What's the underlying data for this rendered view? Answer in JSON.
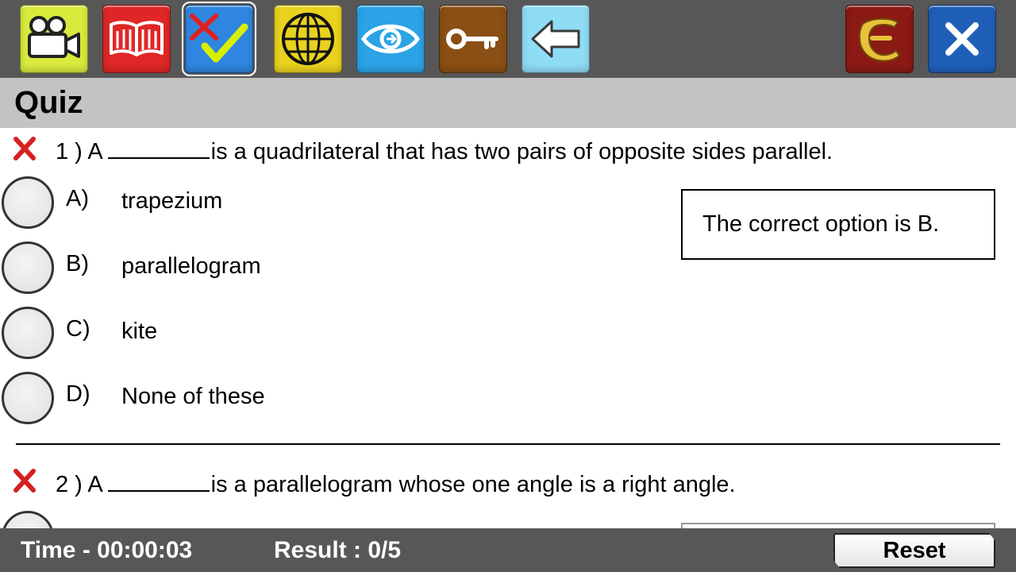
{
  "app": {
    "title": "Quiz"
  },
  "toolbar": {
    "buttons": [
      {
        "icon": "video-camera-icon",
        "color": "#d8ea3c"
      },
      {
        "icon": "open-book-icon",
        "color": "#e02626"
      },
      {
        "icon": "quiz-check-icon",
        "color": "#2f86e0",
        "active": true
      },
      {
        "icon": "globe-icon",
        "color": "#e9d21e"
      },
      {
        "icon": "eye-icon",
        "color": "#2ba3e6"
      },
      {
        "icon": "key-icon",
        "color": "#8a4f14"
      },
      {
        "icon": "back-arrow-icon",
        "color": "#8fdcf5"
      },
      {
        "icon": "brand-logo-icon",
        "color": "#8c1a14"
      },
      {
        "icon": "close-icon",
        "color": "#1f5fb8"
      }
    ]
  },
  "questions": [
    {
      "number": "1 )",
      "prefix": "A",
      "suffix": "is a quadrilateral that has two pairs of opposite sides parallel.",
      "status_icon": "wrong-x-icon",
      "options": [
        {
          "letter": "A)",
          "text": "trapezium"
        },
        {
          "letter": "B)",
          "text": "parallelogram"
        },
        {
          "letter": "C)",
          "text": "kite"
        },
        {
          "letter": "D)",
          "text": "None of these"
        }
      ],
      "feedback": "The correct option is B."
    },
    {
      "number": "2 )",
      "prefix": "A",
      "suffix": "is a parallelogram whose one angle is a right angle.",
      "status_icon": "wrong-x-icon"
    }
  ],
  "status": {
    "time": "Time - 00:00:03",
    "result": "Result : 0/5",
    "reset_label": "Reset"
  },
  "colors": {
    "toolbar_bg": "#575757",
    "titlebar_bg": "#c3c3c3",
    "wrong_mark": "#d42020",
    "check_mark": "#d8f000"
  }
}
